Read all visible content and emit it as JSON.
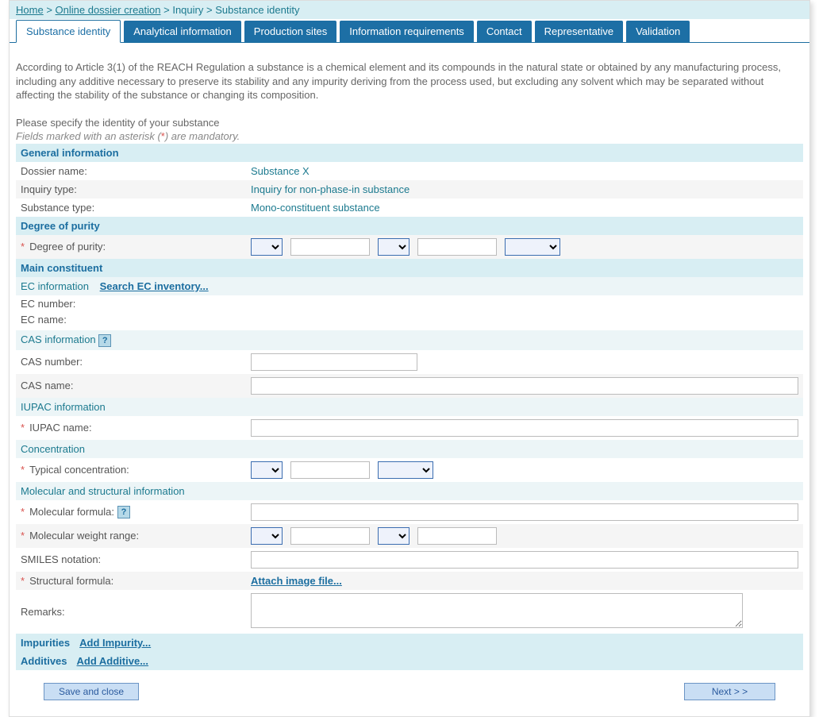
{
  "breadcrumb": {
    "home": "Home",
    "online_dossier": "Online dossier creation",
    "inquiry": "Inquiry",
    "current": "Substance identity"
  },
  "tabs": [
    "Substance identity",
    "Analytical information",
    "Production sites",
    "Information requirements",
    "Contact",
    "Representative",
    "Validation"
  ],
  "intro_text": "According to Article 3(1) of the REACH Regulation a substance is a chemical element and its compounds in the natural state or obtained by any manufacturing process, including any additive necessary to preserve its stability and any impurity deriving from the process used, but excluding any solvent which may be separated without affecting the stability of the substance or changing its composition.",
  "specify_text": "Please specify the identity of your substance",
  "mandatory_note_pre": "Fields marked with an asterisk (",
  "mandatory_note_post": ") are mandatory.",
  "asterisk": "*",
  "sections": {
    "general": {
      "title": "General information",
      "dossier_name_label": "Dossier name:",
      "dossier_name_value": "Substance X",
      "inquiry_type_label": "Inquiry type:",
      "inquiry_type_value": "Inquiry for non-phase-in substance",
      "substance_type_label": "Substance type:",
      "substance_type_value": "Mono-constituent substance"
    },
    "degree_purity": {
      "title": "Degree of purity",
      "label": "Degree of purity:"
    },
    "main_constituent": {
      "title": "Main constituent"
    },
    "ec_info": {
      "title": "EC information",
      "search_link": "Search EC inventory...",
      "ec_number_label": "EC number:",
      "ec_name_label": "EC name:"
    },
    "cas_info": {
      "title": "CAS information",
      "help": "?",
      "cas_number_label": "CAS number:",
      "cas_name_label": "CAS name:"
    },
    "iupac": {
      "title": "IUPAC information",
      "iupac_name_label": "IUPAC name:"
    },
    "concentration": {
      "title": "Concentration",
      "typical_label": "Typical concentration:"
    },
    "molecular": {
      "title": "Molecular and structural information",
      "formula_label": "Molecular formula:",
      "help": "?",
      "weight_label": "Molecular weight range:",
      "smiles_label": "SMILES notation:",
      "structural_label": "Structural formula:",
      "attach_link": "Attach image file...",
      "remarks_label": "Remarks:"
    },
    "impurities": {
      "title": "Impurities",
      "add_link": "Add Impurity..."
    },
    "additives": {
      "title": "Additives",
      "add_link": "Add Additive..."
    }
  },
  "buttons": {
    "save_close": "Save and close",
    "next": "Next > >"
  }
}
